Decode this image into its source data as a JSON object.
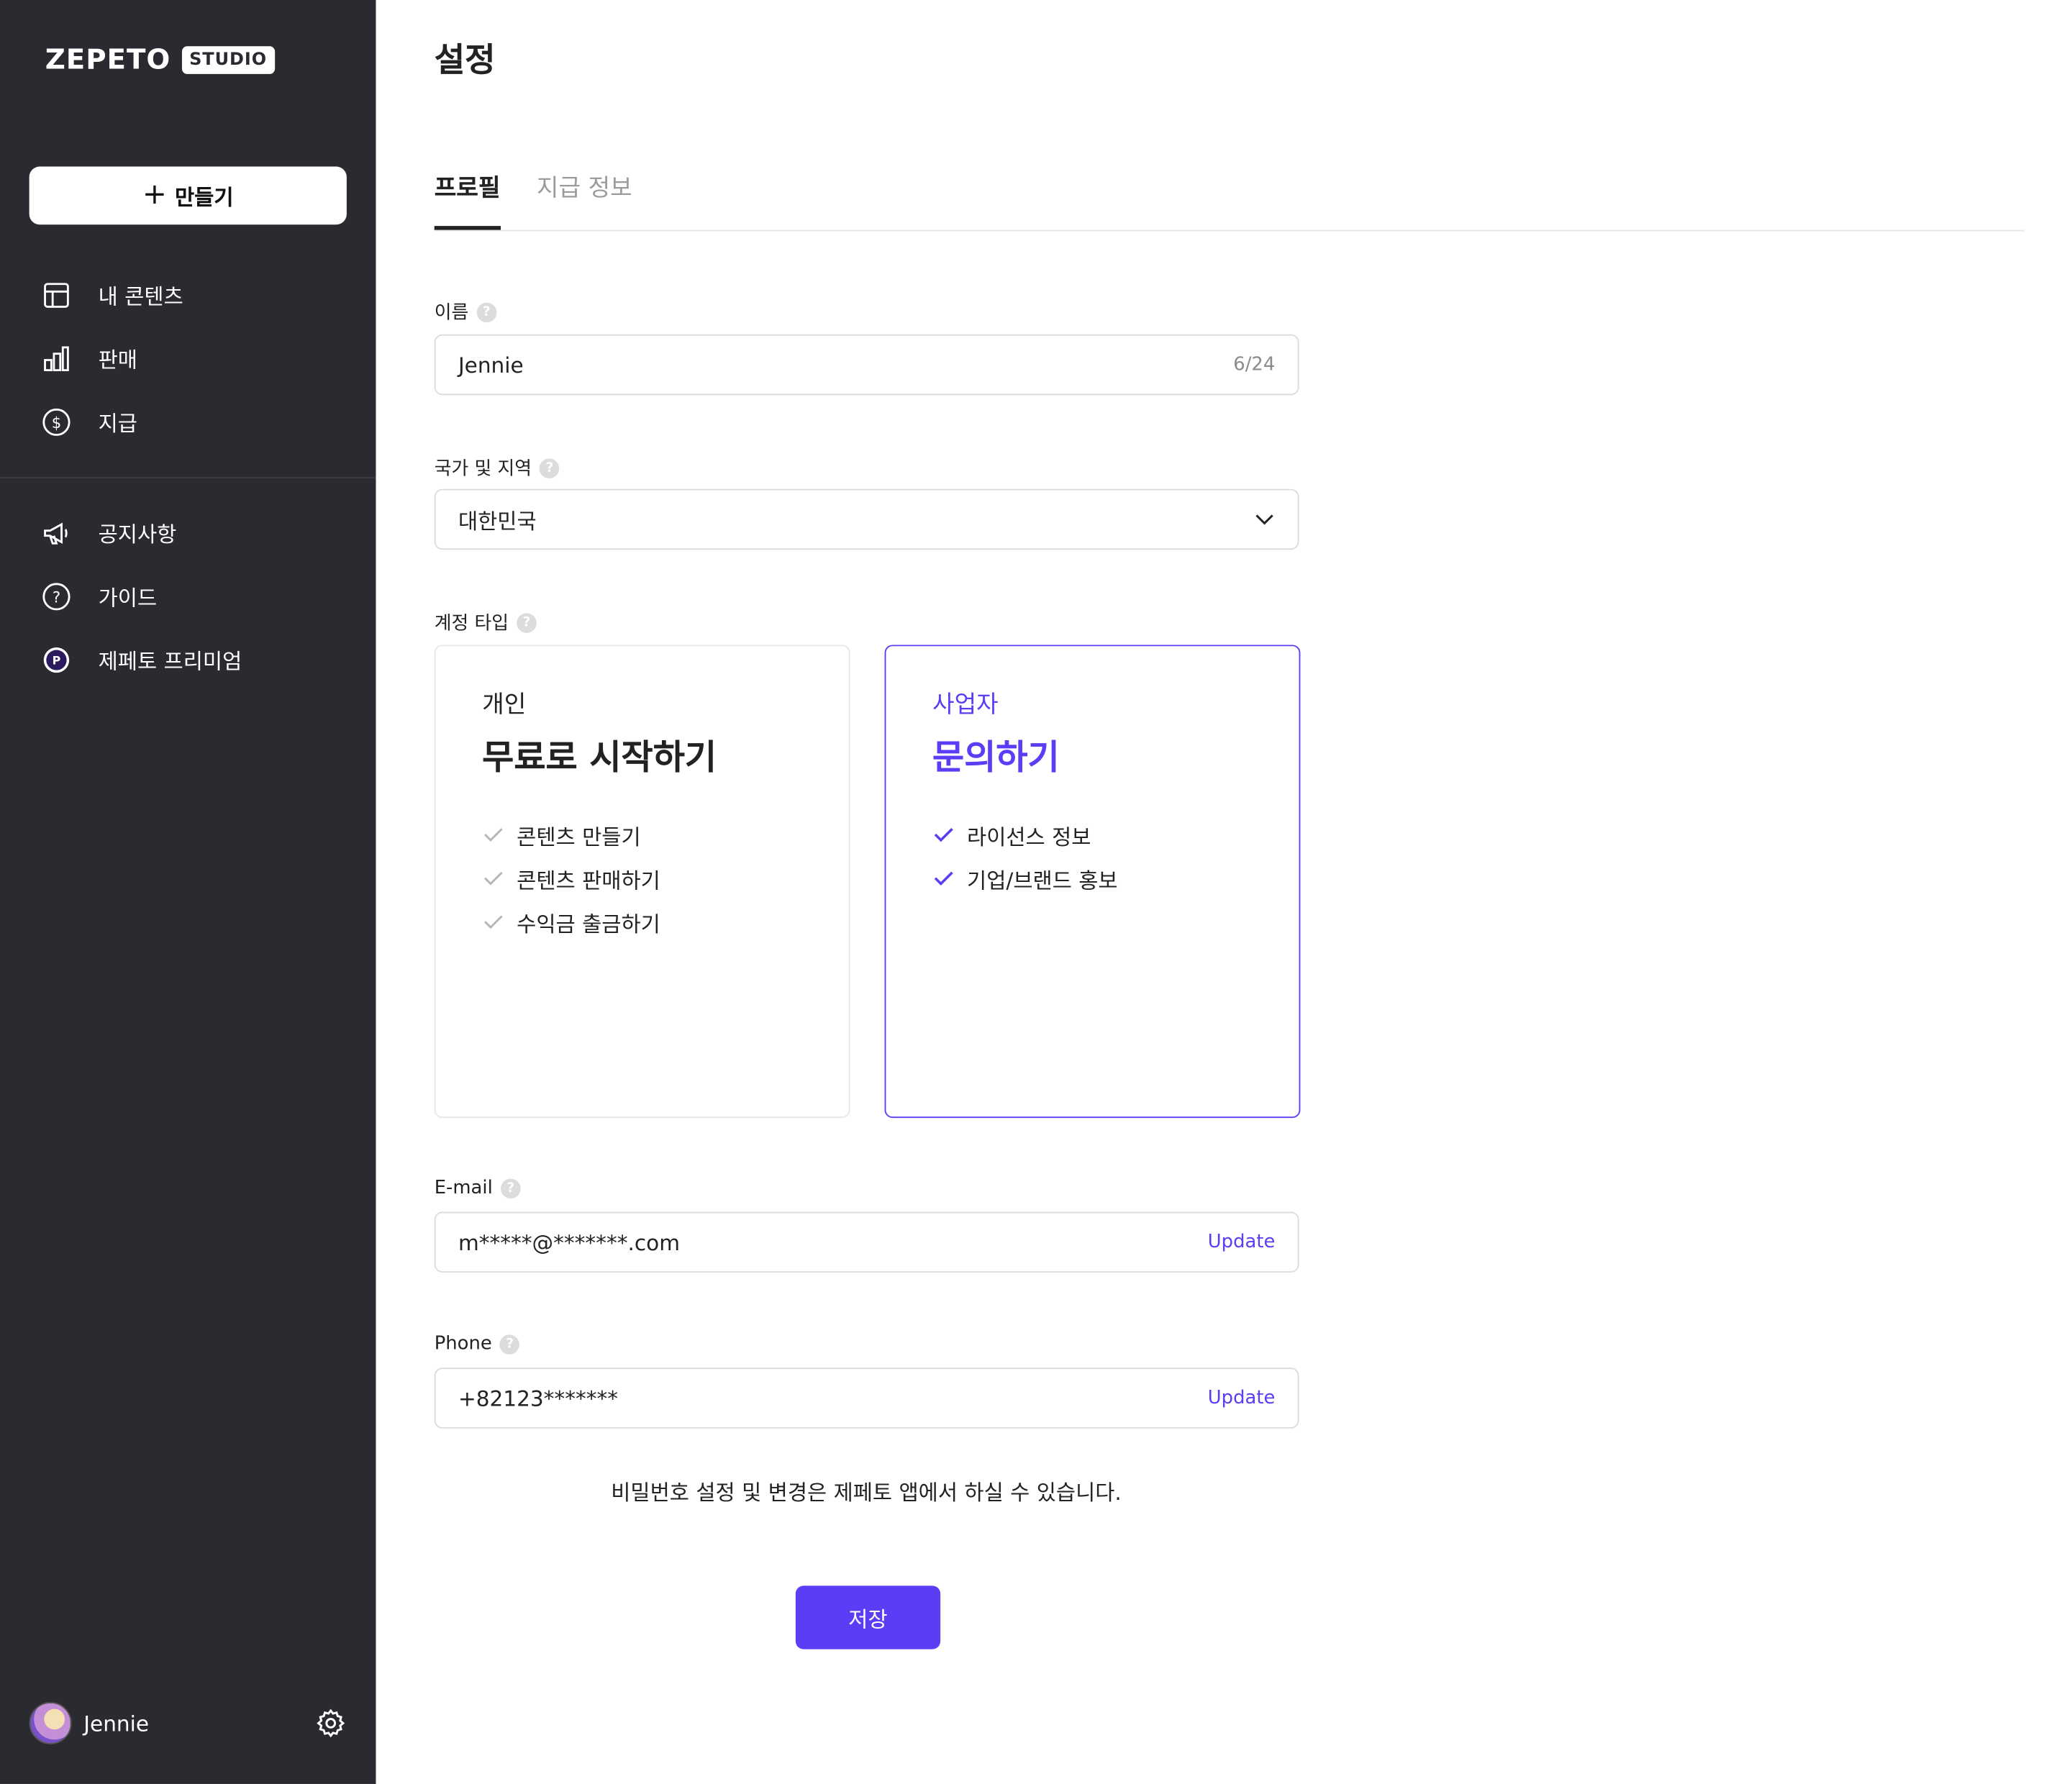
{
  "brand": {
    "wordmark": "ZEPETO",
    "badge": "STUDIO"
  },
  "sidebar": {
    "create_label": "만들기",
    "nav_primary": [
      {
        "label": "내 콘텐츠",
        "icon": "layout-icon"
      },
      {
        "label": "판매",
        "icon": "bar-chart-icon"
      },
      {
        "label": "지급",
        "icon": "dollar-circle-icon"
      }
    ],
    "nav_secondary": [
      {
        "label": "공지사항",
        "icon": "megaphone-icon"
      },
      {
        "label": "가이드",
        "icon": "help-circle-icon"
      },
      {
        "label": "제페토 프리미엄",
        "icon": "premium-badge-icon"
      }
    ],
    "user": {
      "name": "Jennie"
    }
  },
  "page": {
    "title": "설정",
    "tabs": [
      {
        "label": "프로필",
        "active": true
      },
      {
        "label": "지급 정보",
        "active": false
      }
    ]
  },
  "form": {
    "name": {
      "label": "이름",
      "value": "Jennie",
      "counter": "6/24"
    },
    "country": {
      "label": "국가 및 지역",
      "value": "대한민국"
    },
    "account_type": {
      "label": "계정 타입",
      "options": [
        {
          "kind": "개인",
          "headline": "무료로 시작하기",
          "features": [
            "콘텐츠 만들기",
            "콘텐츠 판매하기",
            "수익금 출금하기"
          ],
          "selected": false
        },
        {
          "kind": "사업자",
          "headline": "문의하기",
          "features": [
            "라이선스 정보",
            "기업/브랜드 홍보"
          ],
          "selected": true
        }
      ]
    },
    "email": {
      "label": "E-mail",
      "value": "m*****@*******.com",
      "action": "Update"
    },
    "phone": {
      "label": "Phone",
      "value": "+82123*******",
      "action": "Update"
    },
    "password_note": "비밀번호 설정 및 변경은 제페토 앱에서 하실 수 있습니다.",
    "save_label": "저장"
  },
  "colors": {
    "sidebar_bg": "#2a2b31",
    "accent": "#5b3df5"
  }
}
